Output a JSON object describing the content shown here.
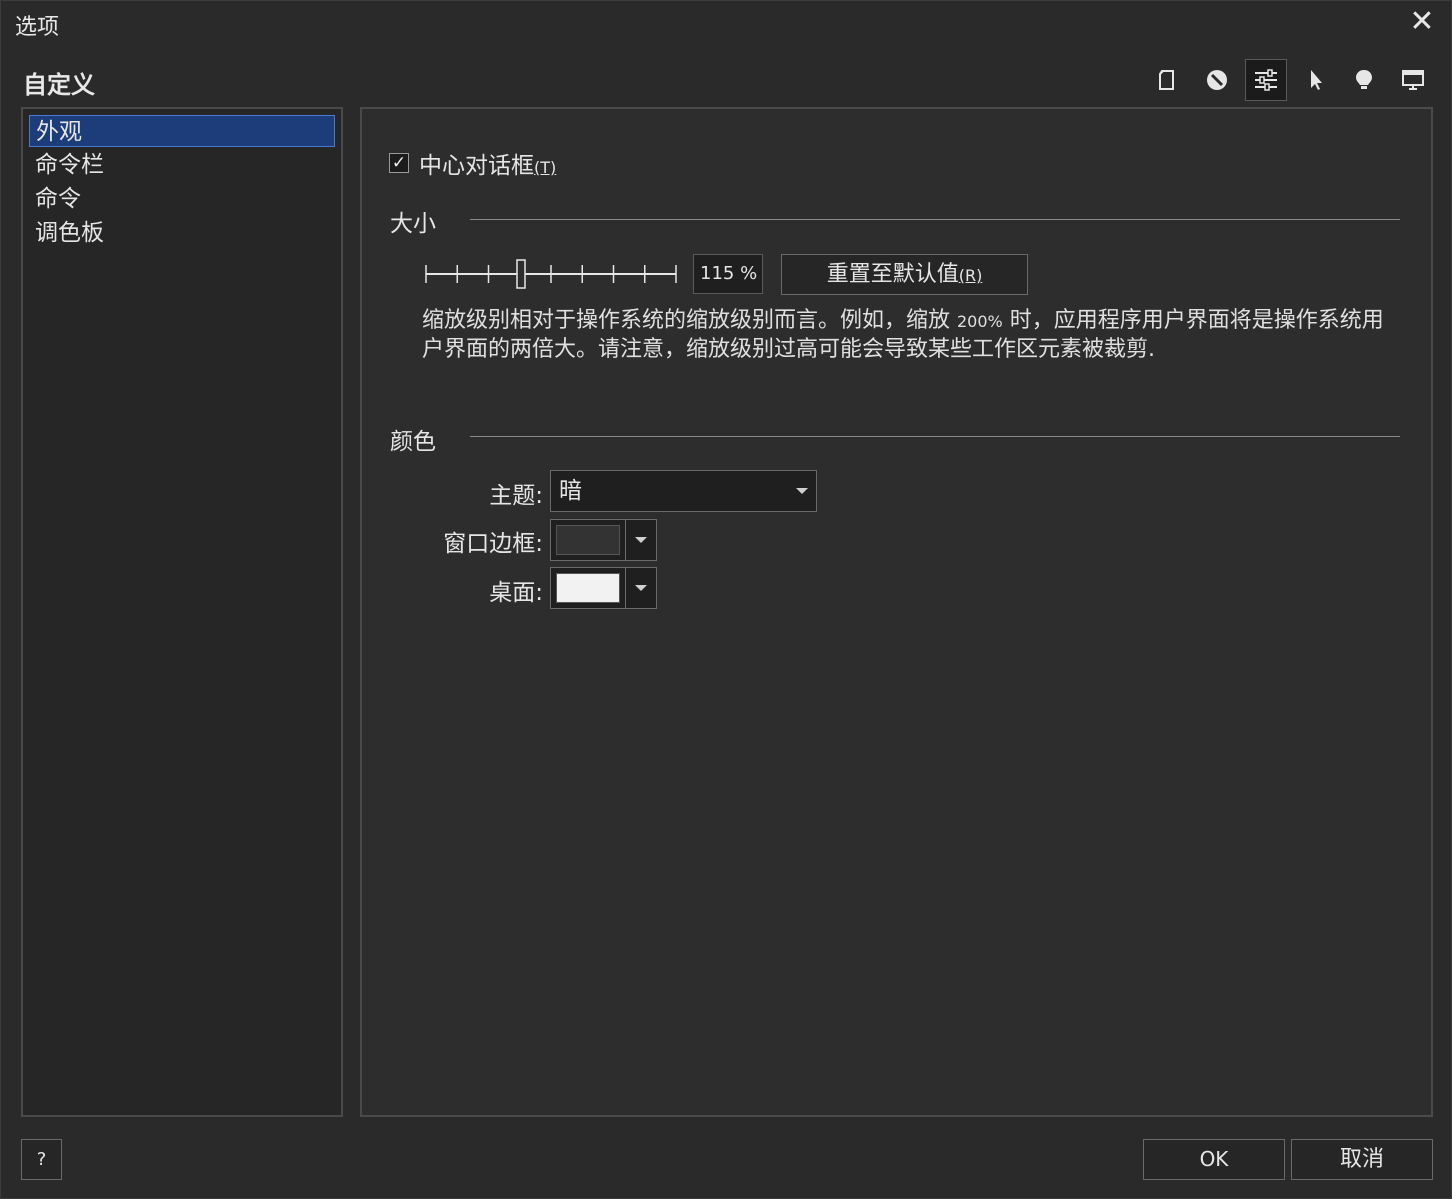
{
  "window": {
    "title": "选项"
  },
  "section_title": "自定义",
  "toolbar": {
    "icons": [
      "document-icon",
      "disabled-icon",
      "sliders-icon",
      "pointer-icon",
      "lightbulb-icon",
      "monitor-icon"
    ],
    "active_index": 2
  },
  "nav": {
    "items": [
      {
        "label": "外观"
      },
      {
        "label": "命令栏"
      },
      {
        "label": "命令"
      },
      {
        "label": "调色板"
      }
    ],
    "selected_index": 0
  },
  "appearance": {
    "center_dialog": {
      "label": "中心对话框",
      "accelerator": "(T)",
      "checked": true
    },
    "size": {
      "label": "大小",
      "zoom_value": "115 %",
      "slider_position": 0.38,
      "reset_label": "重置至默认值",
      "reset_accelerator": "(R)",
      "description_part1": "缩放级别相对于操作系统的缩放级别而言。例如，缩放 ",
      "description_pct": "200%",
      "description_part2": " 时，应用程序用户界面将是操作系统用户界面的两倍大。请注意，缩放级别过高可能会导致某些工作区元素被裁剪."
    },
    "color": {
      "label": "颜色",
      "theme_label": "主题:",
      "theme_value": "暗",
      "border_label": "窗口边框:",
      "border_color": "#333333",
      "desktop_label": "桌面:",
      "desktop_color": "#f2f2f2"
    }
  },
  "footer": {
    "help_label": "?",
    "ok_label": "OK",
    "cancel_label": "取消"
  },
  "colors": {
    "background": "#2a2a2a",
    "selection": "#1d3c7a",
    "selection_border": "#4c79d0"
  }
}
